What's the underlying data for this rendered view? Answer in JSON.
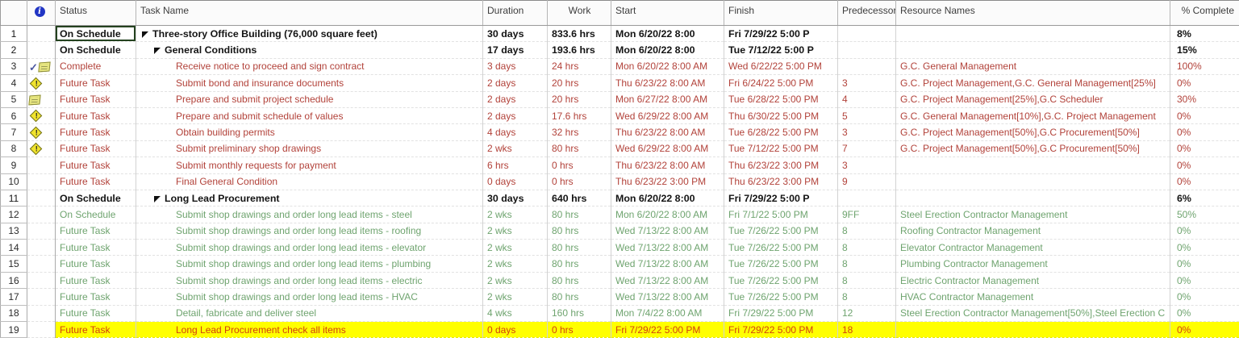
{
  "colors": {
    "red_text": "#b2423a",
    "green_text": "#6fa46f",
    "summary_text": "#141414",
    "highlight_bg": "#ffff00",
    "highlight_text": "#d2400e",
    "warning_yellow": "#f0e32c",
    "note_yellow": "#e7e680",
    "check_blue": "#4b57a0",
    "info_blue": "#2135c4",
    "selection_border": "#24421f"
  },
  "icon_glyphs": {
    "info": "i",
    "check": "✓",
    "warning": "!"
  },
  "header": {
    "columns": [
      {
        "key": "num",
        "label": ""
      },
      {
        "key": "info",
        "label": ""
      },
      {
        "key": "status",
        "label": "Status"
      },
      {
        "key": "task",
        "label": "Task Name"
      },
      {
        "key": "duration",
        "label": "Duration"
      },
      {
        "key": "work",
        "label": "Work"
      },
      {
        "key": "start",
        "label": "Start"
      },
      {
        "key": "finish",
        "label": "Finish"
      },
      {
        "key": "pred",
        "label": "Predecessors"
      },
      {
        "key": "res",
        "label": "Resource Names"
      },
      {
        "key": "pct",
        "label": "% Complete"
      }
    ]
  },
  "rows": [
    {
      "num": "1",
      "icons": [],
      "status": "On Schedule",
      "status_selected": true,
      "task": "Three-story Office Building (76,000 square feet)",
      "indent": 0,
      "caret": true,
      "duration": "30 days",
      "work": "833.6 hrs",
      "start": "Mon 6/20/22 8:00",
      "finish": "Fri 7/29/22 5:00 P",
      "pred": "",
      "res": "",
      "pct": "8%",
      "style": "summary"
    },
    {
      "num": "2",
      "icons": [],
      "status": "On Schedule",
      "task": "General Conditions",
      "indent": 1,
      "caret": true,
      "duration": "17 days",
      "work": "193.6 hrs",
      "start": "Mon 6/20/22 8:00",
      "finish": "Tue 7/12/22 5:00 P",
      "pred": "",
      "res": "",
      "pct": "15%",
      "style": "summary"
    },
    {
      "num": "3",
      "icons": [
        "check",
        "note"
      ],
      "status": "Complete",
      "task": "Receive notice to proceed and sign contract",
      "indent": 2,
      "duration": "3 days",
      "work": "24 hrs",
      "start": "Mon 6/20/22 8:00 AM",
      "finish": "Wed 6/22/22 5:00 PM",
      "pred": "",
      "res": "G.C. General Management",
      "pct": "100%",
      "style": "red"
    },
    {
      "num": "4",
      "icons": [
        "warning"
      ],
      "status": "Future Task",
      "task": "Submit bond and insurance documents",
      "indent": 2,
      "duration": "2 days",
      "work": "20 hrs",
      "start": "Thu 6/23/22 8:00 AM",
      "finish": "Fri 6/24/22 5:00 PM",
      "pred": "3",
      "res": "G.C. Project Management,G.C. General Management[25%]",
      "pct": "0%",
      "style": "red"
    },
    {
      "num": "5",
      "icons": [
        "note"
      ],
      "status": "Future Task",
      "task": "Prepare and submit project schedule",
      "indent": 2,
      "duration": "2 days",
      "work": "20 hrs",
      "start": "Mon 6/27/22 8:00 AM",
      "finish": "Tue 6/28/22 5:00 PM",
      "pred": "4",
      "res": "G.C. Project Management[25%],G.C Scheduler",
      "pct": "30%",
      "style": "red"
    },
    {
      "num": "6",
      "icons": [
        "warning"
      ],
      "status": "Future Task",
      "task": "Prepare and submit schedule of values",
      "indent": 2,
      "duration": "2 days",
      "work": "17.6 hrs",
      "start": "Wed 6/29/22 8:00 AM",
      "finish": "Thu 6/30/22 5:00 PM",
      "pred": "5",
      "res": "G.C. General Management[10%],G.C. Project Management",
      "pct": "0%",
      "style": "red"
    },
    {
      "num": "7",
      "icons": [
        "warning"
      ],
      "status": "Future Task",
      "task": "Obtain building permits",
      "indent": 2,
      "duration": "4 days",
      "work": "32 hrs",
      "start": "Thu 6/23/22 8:00 AM",
      "finish": "Tue 6/28/22 5:00 PM",
      "pred": "3",
      "res": "G.C. Project Management[50%],G.C Procurement[50%]",
      "pct": "0%",
      "style": "red"
    },
    {
      "num": "8",
      "icons": [
        "warning"
      ],
      "status": "Future Task",
      "task": "Submit preliminary shop drawings",
      "indent": 2,
      "duration": "2 wks",
      "work": "80 hrs",
      "start": "Wed 6/29/22 8:00 AM",
      "finish": "Tue 7/12/22 5:00 PM",
      "pred": "7",
      "res": "G.C. Project Management[50%],G.C Procurement[50%]",
      "pct": "0%",
      "style": "red"
    },
    {
      "num": "9",
      "icons": [],
      "status": "Future Task",
      "task": "Submit monthly requests for payment",
      "indent": 2,
      "duration": "6 hrs",
      "work": "0 hrs",
      "start": "Thu 6/23/22 8:00 AM",
      "finish": "Thu 6/23/22 3:00 PM",
      "pred": "3",
      "res": "",
      "pct": "0%",
      "style": "red"
    },
    {
      "num": "10",
      "icons": [],
      "status": "Future Task",
      "task": "Final General Condition",
      "indent": 2,
      "duration": "0 days",
      "work": "0 hrs",
      "start": "Thu 6/23/22 3:00 PM",
      "finish": "Thu 6/23/22 3:00 PM",
      "pred": "9",
      "res": "",
      "pct": "0%",
      "style": "red"
    },
    {
      "num": "11",
      "icons": [],
      "status": "On Schedule",
      "task": "Long Lead Procurement",
      "indent": 1,
      "caret": true,
      "duration": "30 days",
      "work": "640 hrs",
      "start": "Mon 6/20/22 8:00",
      "finish": "Fri 7/29/22 5:00 P",
      "pred": "",
      "res": "",
      "pct": "6%",
      "style": "summary"
    },
    {
      "num": "12",
      "icons": [],
      "status": "On Schedule",
      "task": "Submit shop drawings and order long lead items - steel",
      "indent": 2,
      "duration": "2 wks",
      "work": "80 hrs",
      "start": "Mon 6/20/22 8:00 AM",
      "finish": "Fri 7/1/22 5:00 PM",
      "pred": "9FF",
      "res": "Steel Erection Contractor Management",
      "pct": "50%",
      "style": "green"
    },
    {
      "num": "13",
      "icons": [],
      "status": "Future Task",
      "task": "Submit shop drawings and order long lead items - roofing",
      "indent": 2,
      "duration": "2 wks",
      "work": "80 hrs",
      "start": "Wed 7/13/22 8:00 AM",
      "finish": "Tue 7/26/22 5:00 PM",
      "pred": "8",
      "res": "Roofing Contractor Management",
      "pct": "0%",
      "style": "green"
    },
    {
      "num": "14",
      "icons": [],
      "status": "Future Task",
      "task": "Submit shop drawings and order long lead items - elevator",
      "indent": 2,
      "duration": "2 wks",
      "work": "80 hrs",
      "start": "Wed 7/13/22 8:00 AM",
      "finish": "Tue 7/26/22 5:00 PM",
      "pred": "8",
      "res": "Elevator Contractor Management",
      "pct": "0%",
      "style": "green"
    },
    {
      "num": "15",
      "icons": [],
      "status": "Future Task",
      "task": "Submit shop drawings and order long lead items - plumbing",
      "indent": 2,
      "duration": "2 wks",
      "work": "80 hrs",
      "start": "Wed 7/13/22 8:00 AM",
      "finish": "Tue 7/26/22 5:00 PM",
      "pred": "8",
      "res": "Plumbing Contractor Management",
      "pct": "0%",
      "style": "green"
    },
    {
      "num": "16",
      "icons": [],
      "status": "Future Task",
      "task": "Submit shop drawings and order long lead items - electric",
      "indent": 2,
      "duration": "2 wks",
      "work": "80 hrs",
      "start": "Wed 7/13/22 8:00 AM",
      "finish": "Tue 7/26/22 5:00 PM",
      "pred": "8",
      "res": "Electric Contractor Management",
      "pct": "0%",
      "style": "green"
    },
    {
      "num": "17",
      "icons": [],
      "status": "Future Task",
      "task": "Submit shop drawings and order long lead items - HVAC",
      "indent": 2,
      "duration": "2 wks",
      "work": "80 hrs",
      "start": "Wed 7/13/22 8:00 AM",
      "finish": "Tue 7/26/22 5:00 PM",
      "pred": "8",
      "res": "HVAC Contractor Management",
      "pct": "0%",
      "style": "green"
    },
    {
      "num": "18",
      "icons": [],
      "status": "Future Task",
      "task": "Detail, fabricate and deliver steel",
      "indent": 2,
      "duration": "4 wks",
      "work": "160 hrs",
      "start": "Mon 7/4/22 8:00 AM",
      "finish": "Fri 7/29/22 5:00 PM",
      "pred": "12",
      "res": "Steel Erection Contractor Management[50%],Steel Erection C",
      "pct": "0%",
      "style": "green"
    },
    {
      "num": "19",
      "icons": [],
      "status": "Future Task",
      "task": "Long Lead Procurement check all items",
      "indent": 2,
      "duration": "0 days",
      "work": "0 hrs",
      "start": "Fri 7/29/22 5:00 PM",
      "finish": "Fri 7/29/22 5:00 PM",
      "pred": "18",
      "res": "",
      "pct": "0%",
      "style": "highlight"
    }
  ]
}
